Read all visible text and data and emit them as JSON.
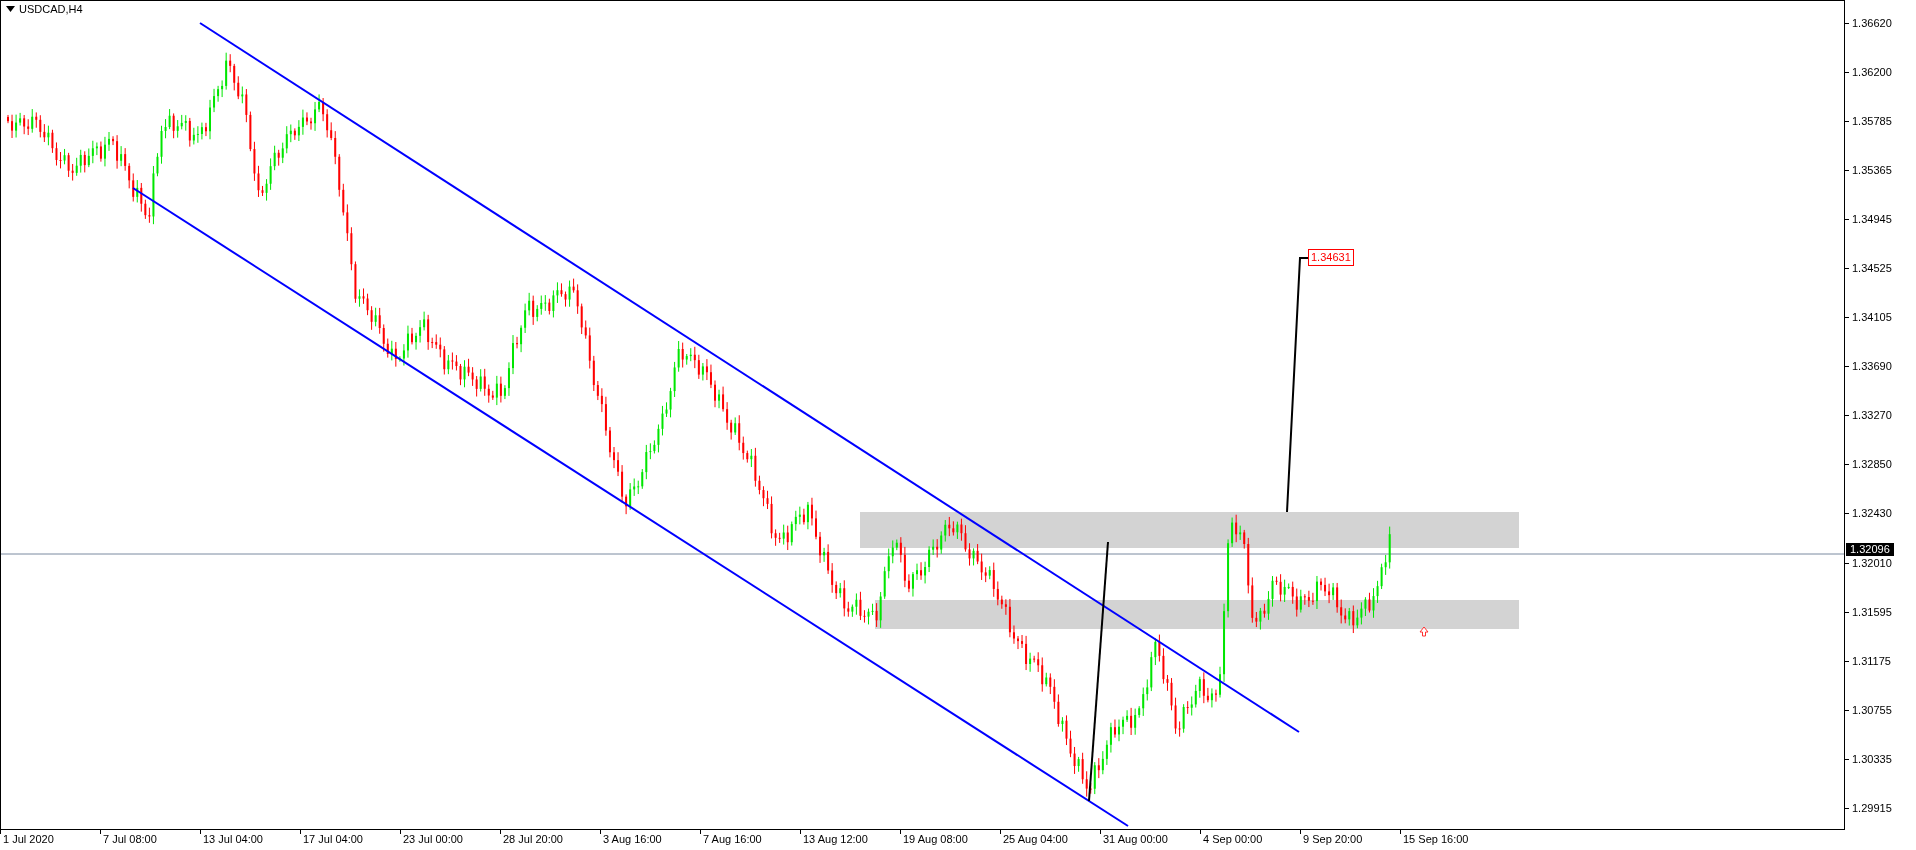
{
  "chart": {
    "symbol_title": "USDCAD,H4",
    "price_labels": [
      "1.36620",
      "1.36200",
      "1.35785",
      "1.35365",
      "1.34945",
      "1.34525",
      "1.34105",
      "1.33690",
      "1.33270",
      "1.32850",
      "1.32430",
      "1.32010",
      "1.31595",
      "1.31175",
      "1.30755",
      "1.30335",
      "1.29915"
    ],
    "time_labels": [
      "1 Jul 2020",
      "7 Jul 08:00",
      "13 Jul 04:00",
      "17 Jul 04:00",
      "23 Jul 00:00",
      "28 Jul 20:00",
      "3 Aug 16:00",
      "7 Aug 16:00",
      "13 Aug 12:00",
      "19 Aug 08:00",
      "25 Aug 04:00",
      "31 Aug 00:00",
      "4 Sep 00:00",
      "9 Sep 20:00",
      "15 Sep 16:00"
    ],
    "current_price": "1.32096",
    "price_marker": "1.34631"
  }
}
